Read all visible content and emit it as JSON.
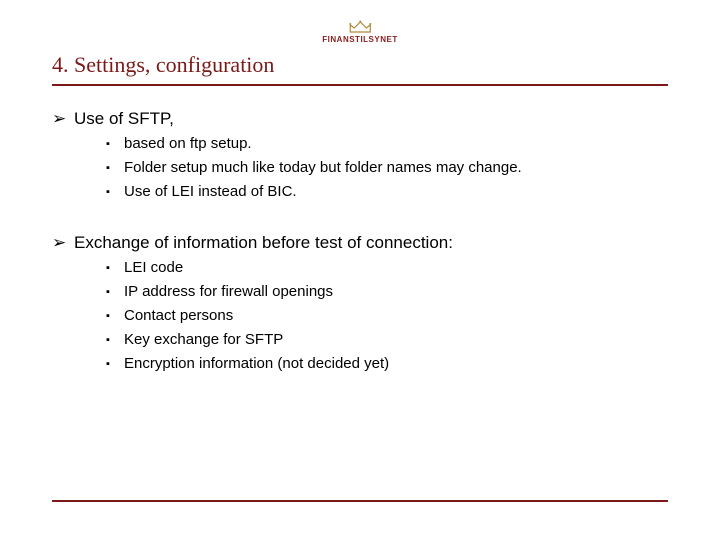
{
  "logo": {
    "org_label": "FINANSTILSYNET"
  },
  "title": "4. Settings, configuration",
  "bullets": [
    {
      "text": "Use of SFTP,",
      "sub": [
        "based on ftp setup.",
        "Folder setup much like today but folder names may change.",
        "Use of LEI instead of BIC."
      ]
    },
    {
      "text": "Exchange of information before test of connection:",
      "sub": [
        "LEI code",
        "IP address for firewall openings",
        "Contact persons",
        "Key exchange for SFTP",
        "Encryption information (not decided yet)"
      ]
    }
  ],
  "glyphs": {
    "l1": "➢",
    "l2": "▪"
  },
  "colors": {
    "accent": "#7a1a17"
  }
}
